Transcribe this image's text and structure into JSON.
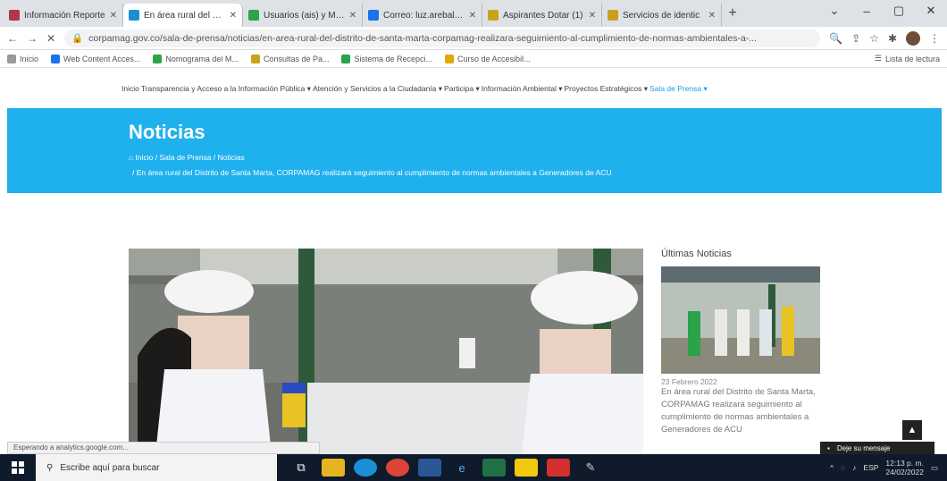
{
  "browser": {
    "tabs": [
      {
        "title": "Información Reporte",
        "color": "#b0364a"
      },
      {
        "title": "En área rural del Distr",
        "color": "#1c8fd0",
        "active": true
      },
      {
        "title": "Usuarios (ais) y Medi",
        "color": "#2aa34a"
      },
      {
        "title": "Correo: luz.arebal.us",
        "color": "#1a73e8"
      },
      {
        "title": "Aspirantes Dotar (1)",
        "color": "#c9a21c"
      },
      {
        "title": "Servicios de identic",
        "color": "#c9a21c"
      }
    ],
    "new_tab": "+",
    "window_controls": [
      "⌄",
      "–",
      "▢",
      "✕"
    ],
    "url": "corpamag.gov.co/sala-de-prensa/noticias/en-area-rural-del-distrito-de-santa-marta-corpamag-realizara-seguimiento-al-cumplimiento-de-normas-ambientales-a-...",
    "bookmarks": [
      {
        "label": "Inicio",
        "color": "#999999"
      },
      {
        "label": "Web Content Acces...",
        "color": "#1a73e8"
      },
      {
        "label": "Nomograma del M...",
        "color": "#2aa34a"
      },
      {
        "label": "Consultas de Pa...",
        "color": "#c9a21c"
      },
      {
        "label": "Sistema de Recepci...",
        "color": "#2aa34a"
      },
      {
        "label": "Curso de Accesibil...",
        "color": "#e0a800"
      }
    ],
    "bookmarks_right": "Lista de lectura"
  },
  "site": {
    "menu": [
      "Inicio",
      "Transparencia y Acceso a la Información Pública ▾",
      "Atención y Servicios a la Ciudadanía ▾",
      "Participa ▾",
      "Información Ambiental ▾",
      "Proyectos Estratégicos ▾",
      "Sala de Prensa ▾"
    ],
    "hero_title": "Noticias",
    "breadcrumb": "Inicio  /  Sala de Prensa  /  Noticias",
    "breadcrumb_current": "/  En área rural del Distrito de Santa Marta, CORPAMAG realizará seguimiento al cumplimiento de normas ambientales a Generadores de ACU",
    "sidebar": {
      "title": "Últimas Noticias",
      "date": "23 Febrero 2022",
      "text": "En área rural del Distrito de Santa Marta, CORPAMAG realizará seguimiento al cumplimiento de normas ambientales a Generadores de ACU"
    },
    "status": "Esperando a analytics.google.com...",
    "chat": "Deje su mensaje"
  },
  "taskbar": {
    "search_placeholder": "Escribe aquí para buscar",
    "tray_lang": "ESP",
    "time": "12:13 p. m.",
    "date": "24/02/2022"
  }
}
